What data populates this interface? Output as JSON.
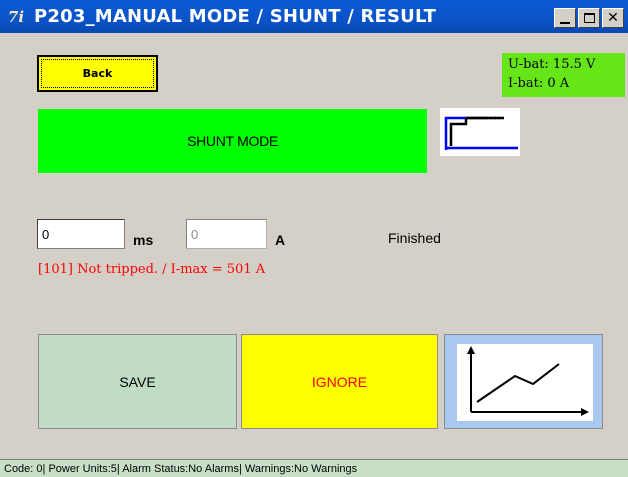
{
  "window": {
    "title": "P203_MANUAL MODE / SHUNT / RESULT",
    "app_icon": "7i",
    "controls": {
      "minimize": "_",
      "maximize": "□",
      "close": "✕"
    }
  },
  "back": {
    "label": "Back"
  },
  "battery": {
    "voltage": "U-bat: 15.5 V",
    "current": "I-bat: 0 A"
  },
  "mode": {
    "label": "SHUNT MODE",
    "icon": "step-waveform-icon"
  },
  "inputs": {
    "time_value": "0",
    "time_unit": "ms",
    "current_value": "0",
    "current_unit": "A"
  },
  "status": "Finished",
  "result_message": "[101] Not tripped. / I-max = 501 A",
  "actions": {
    "save": "SAVE",
    "ignore": "IGNORE",
    "graph_icon": "line-graph-icon"
  },
  "statusbar": {
    "text": "Code: 0| Power Units:5| Alarm Status:No Alarms| Warnings:No Warnings"
  },
  "colors": {
    "title_bar": "#0a53c8",
    "back_button": "#ffff00",
    "battery_panel": "#66e619",
    "mode_banner": "#00ff00",
    "save_button": "#c1dcc4",
    "ignore_button": "#ffff00",
    "ignore_text": "#ff0000",
    "graph_button": "#a8c8f0",
    "error_text": "#ff0000"
  }
}
